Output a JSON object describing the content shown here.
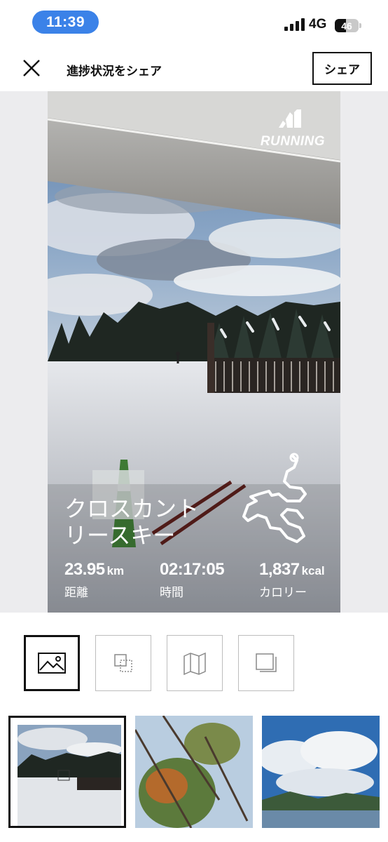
{
  "status_bar": {
    "time": "11:39",
    "network": "4G",
    "battery": "46",
    "battery_level": 0.46
  },
  "header": {
    "title": "進捗状況をシェア",
    "share_label": "シェア",
    "close_icon": "close-icon"
  },
  "card": {
    "brand_word": "RUNNING",
    "activity_name": "クロスカントリースキー",
    "stats": [
      {
        "value": "23.95",
        "unit": "km",
        "label": "距離"
      },
      {
        "value": "02:17:05",
        "unit": "",
        "label": "時間"
      },
      {
        "value": "1,837",
        "unit": "kcal",
        "label": "カロリー"
      }
    ]
  },
  "templates": [
    {
      "icon": "image-icon",
      "selected": true
    },
    {
      "icon": "layers-icon",
      "selected": false
    },
    {
      "icon": "map-icon",
      "selected": false
    },
    {
      "icon": "stack-icon",
      "selected": false
    }
  ],
  "thumbnails": [
    {
      "subject": "ski-field-photo",
      "selected": true
    },
    {
      "subject": "tree-photo",
      "selected": false
    },
    {
      "subject": "clouds-lake-photo",
      "selected": false
    }
  ]
}
